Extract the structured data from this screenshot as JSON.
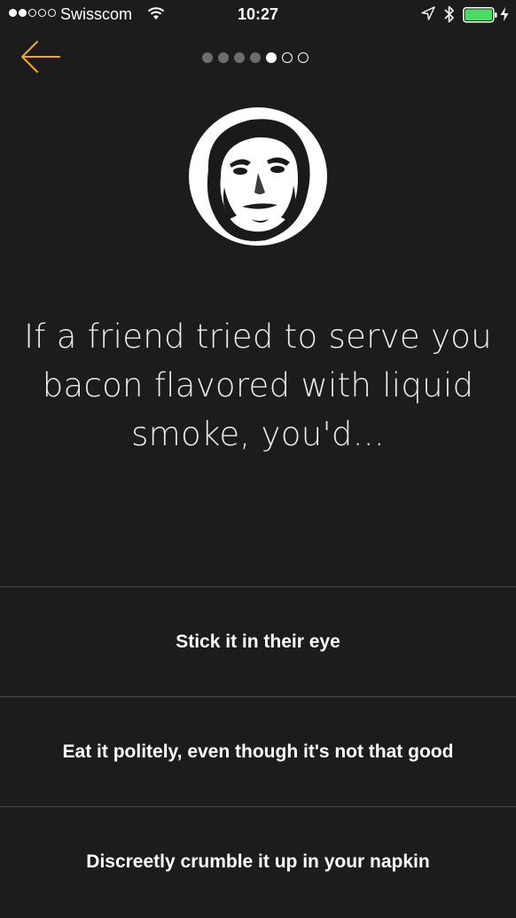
{
  "status_bar": {
    "carrier": "Swisscom",
    "time": "10:27",
    "signal_bars_filled": 2,
    "signal_bars_total": 5,
    "icons": [
      "wifi-icon",
      "location-arrow-icon",
      "bluetooth-icon",
      "battery-icon",
      "charging-bolt-icon"
    ],
    "battery_level": 1.0,
    "battery_color": "#4cd964"
  },
  "nav": {
    "back_icon": "arrow-left-icon",
    "back_color": "#f5a623",
    "progress": {
      "current_step": 5,
      "total_steps": 7
    }
  },
  "avatar": {
    "icon": "user-portrait"
  },
  "question": {
    "text": "If a friend tried to serve you bacon flavored with liquid smoke, you'd..."
  },
  "answers": [
    {
      "label": "Stick it in their eye"
    },
    {
      "label": "Eat it politely, even though it's not that good"
    },
    {
      "label": "Discreetly crumble it up in your napkin"
    }
  ],
  "colors": {
    "background": "#1c1c1c",
    "divider": "#4a4a4a",
    "accent": "#f5a623"
  }
}
